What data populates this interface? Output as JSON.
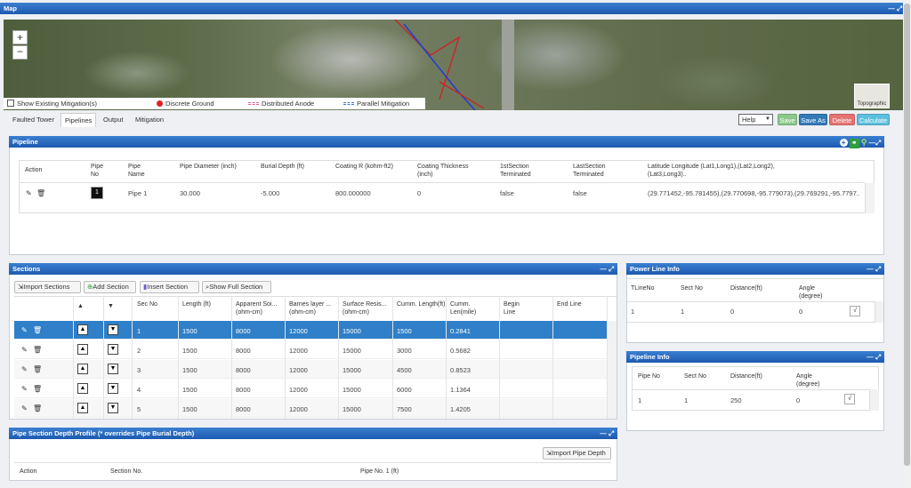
{
  "map": {
    "title": "Map",
    "zoom_in": "+",
    "zoom_out": "−",
    "show_existing_label": "Show Existing Mitigation(s)",
    "legend": [
      "Discrete Ground",
      "Distributed Anode",
      "Parallel Mitigation"
    ],
    "legend_colors": [
      "#e02020",
      "#e060a0",
      "#4a6fd8"
    ],
    "basemap_label": "Topographic"
  },
  "tabs": [
    "Faulted Tower",
    "Pipelines",
    "Output",
    "Mitigation"
  ],
  "active_tab": "Pipelines",
  "toolbar": {
    "help": "Help",
    "save": "Save",
    "save_as": "Save As",
    "delete": "Delete",
    "calculate": "Calculate",
    "colors": {
      "save": "#5cb85c",
      "save_as": "#337ab7",
      "delete": "#e57373",
      "calculate": "#5bc0de"
    }
  },
  "pipeline": {
    "title": "Pipeline",
    "headers": [
      "Action",
      "Pipe No",
      "Pipe Name",
      "Pipe Diameter (inch)",
      "Burial Depth (ft)",
      "Coating R (kohm-ft2)",
      "Coating Thickness (inch)",
      "1stSection Terminated",
      "LastSection Terminated",
      "Latitude Longitude (Lat1,Long1),(Lat2,Long2),(Lat3,Long3).."
    ],
    "row": {
      "no": "1",
      "name": "Pipe 1",
      "diameter": "30.000",
      "depth": "-5.000",
      "coating_r": "800.000000",
      "thickness": "0",
      "first_term": "false",
      "last_term": "false",
      "latlong": "(29.771452,-95.781455),(29.770698,-95.779073),(29.769291,-95.7797..."
    }
  },
  "sections": {
    "title": "Sections",
    "buttons": [
      "Import Sections",
      "Add Section",
      "Insert Section",
      "Show Full Section"
    ],
    "headers": [
      "",
      "▲",
      "▼",
      "Sec No",
      "Length (ft)",
      "Apparent Soi... (ohm-cm)",
      "Barnes layer ... (ohm-cm)",
      "Surface Resis... (ohm-cm)",
      "Cumm. Length(ft)",
      "Cumm. Len(mile)",
      "Begin Line",
      "End Line"
    ],
    "rows": [
      {
        "no": "1",
        "length": "1500",
        "apparent": "8000",
        "barnes": "12000",
        "surface": "15000",
        "cum_ft": "1500",
        "cum_mi": "0.2841"
      },
      {
        "no": "2",
        "length": "1500",
        "apparent": "8000",
        "barnes": "12000",
        "surface": "15000",
        "cum_ft": "3000",
        "cum_mi": "0.5682"
      },
      {
        "no": "3",
        "length": "1500",
        "apparent": "8000",
        "barnes": "12000",
        "surface": "15000",
        "cum_ft": "4500",
        "cum_mi": "0.8523"
      },
      {
        "no": "4",
        "length": "1500",
        "apparent": "8000",
        "barnes": "12000",
        "surface": "15000",
        "cum_ft": "6000",
        "cum_mi": "1.1364"
      },
      {
        "no": "5",
        "length": "1500",
        "apparent": "8000",
        "barnes": "12000",
        "surface": "15000",
        "cum_ft": "7500",
        "cum_mi": "1.4205"
      }
    ]
  },
  "power": {
    "title": "Power Line Info",
    "headers": [
      "TLineNo",
      "Sect No",
      "Distance(ft)",
      "Angle (degree)"
    ],
    "row": [
      "1",
      "1",
      "0",
      "0"
    ]
  },
  "pipeinfo": {
    "title": "Pipeline Info",
    "headers": [
      "Pipe No",
      "Sect No",
      "Distance(ft)",
      "Angle (degree)"
    ],
    "row": [
      "1",
      "1",
      "250",
      "0"
    ]
  },
  "depth": {
    "title": "Pipe Section Depth Profile (* overrides Pipe Burial Depth)",
    "import": "Import Pipe Depth",
    "headers": [
      "Action",
      "Section No.",
      "Pipe No. 1 (ft)"
    ]
  },
  "icons": {
    "edit": "edit-icon",
    "trash": "trash-icon",
    "min": "minimize-icon",
    "max": "expand-icon"
  }
}
